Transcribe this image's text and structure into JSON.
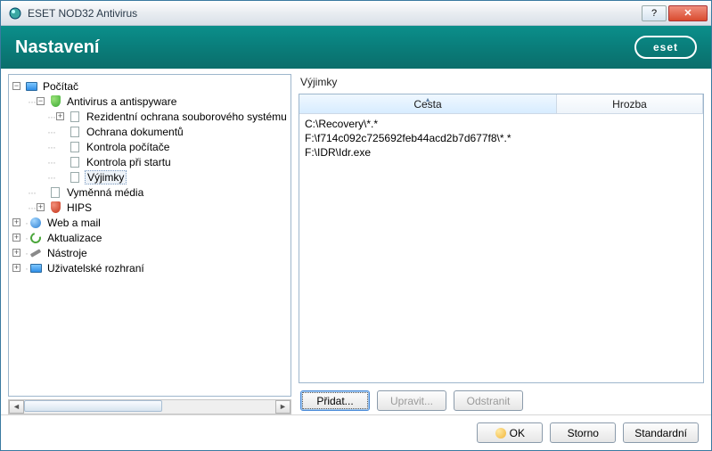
{
  "window": {
    "title": "ESET NOD32 Antivirus",
    "help_tooltip": "?",
    "close_tooltip": "✕"
  },
  "banner": {
    "heading": "Nastavení",
    "logo_text": "eset"
  },
  "tree": {
    "root": "Počítač",
    "av_root": "Antivirus a antispyware",
    "av_children": {
      "realtime": "Rezidentní ochrana souborového systému",
      "documents": "Ochrana dokumentů",
      "computer_scan": "Kontrola počítače",
      "startup_scan": "Kontrola při startu",
      "exclusions": "Výjimky"
    },
    "removable": "Vyměnná média",
    "hips": "HIPS",
    "web_mail": "Web a mail",
    "update": "Aktualizace",
    "tools": "Nástroje",
    "ui": "Uživatelské rozhraní"
  },
  "right": {
    "section_label": "Výjimky",
    "columns": {
      "path": "Cesta",
      "threat": "Hrozba"
    },
    "rows": [
      {
        "path": "C:\\Recovery\\*.*",
        "threat": ""
      },
      {
        "path": "F:\\f714c092c725692feb44acd2b7d677f8\\*.*",
        "threat": ""
      },
      {
        "path": "F:\\IDR\\Idr.exe",
        "threat": ""
      }
    ],
    "buttons": {
      "add": "Přidat...",
      "edit": "Upravit...",
      "remove": "Odstranit"
    }
  },
  "footer": {
    "ok": "OK",
    "cancel": "Storno",
    "default": "Standardní"
  }
}
